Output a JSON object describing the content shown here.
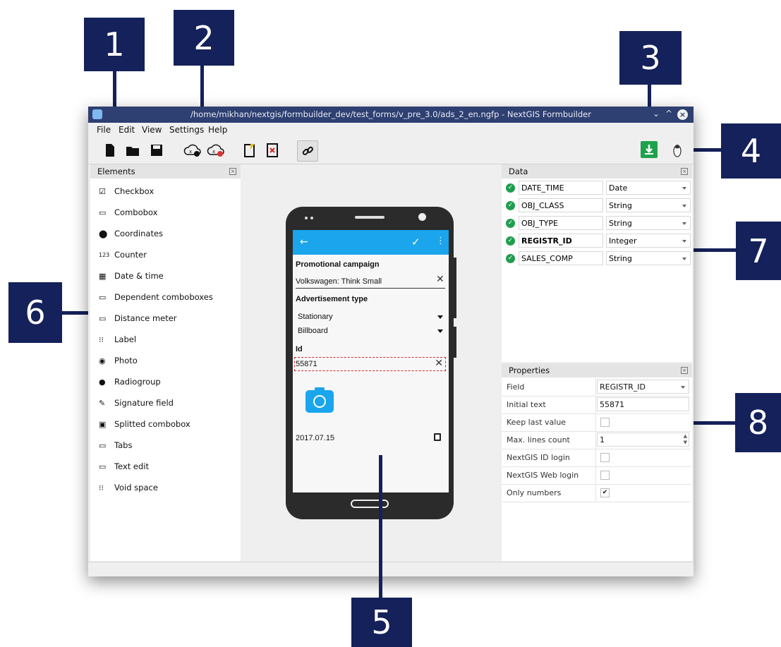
{
  "callouts": [
    "1",
    "2",
    "3",
    "4",
    "5",
    "6",
    "7",
    "8"
  ],
  "window": {
    "title": "/home/mikhan/nextgis/formbuilder_dev/test_forms/v_pre_3.0/ads_2_en.ngfp - NextGIS Formbuilder",
    "controls": {
      "minimize": "⌄",
      "maximize": "^",
      "close": "×"
    }
  },
  "menu": [
    "File",
    "Edit",
    "View",
    "Settings",
    "Help"
  ],
  "toolbar": {
    "icons": [
      "new-file-icon",
      "open-folder-icon",
      "save-icon",
      "cloud-upload-icon",
      "cloud-download-icon",
      "edit-form-icon",
      "delete-form-icon",
      "link-icon",
      "download-icon",
      "tux-icon"
    ]
  },
  "elements": {
    "title": "Elements",
    "items": [
      {
        "icon": "☑",
        "label": "Checkbox"
      },
      {
        "icon": "▭",
        "label": "Combobox"
      },
      {
        "icon": "⬤",
        "label": "Coordinates"
      },
      {
        "icon": "123",
        "label": "Counter"
      },
      {
        "icon": "▦",
        "label": "Date & time"
      },
      {
        "icon": "▭",
        "label": "Dependent comboboxes"
      },
      {
        "icon": "▭",
        "label": "Distance meter"
      },
      {
        "icon": "⁝⁝",
        "label": "Label"
      },
      {
        "icon": "◉",
        "label": "Photo"
      },
      {
        "icon": "●",
        "label": "Radiogroup"
      },
      {
        "icon": "✎",
        "label": "Signature field"
      },
      {
        "icon": "▣",
        "label": "Splitted combobox"
      },
      {
        "icon": "▭",
        "label": "Tabs"
      },
      {
        "icon": "▭",
        "label": "Text edit"
      },
      {
        "icon": "⁝⁝",
        "label": "Void space"
      }
    ]
  },
  "phone_form": {
    "section1": "Promotional campaign",
    "field1_value": "Volkswagen: Think Small",
    "section2": "Advertisement type",
    "select1": "Stationary",
    "select2": "Billboard",
    "section3": "Id",
    "id_value": "55871",
    "date_value": "2017.07.15"
  },
  "data": {
    "title": "Data",
    "rows": [
      {
        "name": "DATE_TIME",
        "type": "Date"
      },
      {
        "name": "OBJ_CLASS",
        "type": "String"
      },
      {
        "name": "OBJ_TYPE",
        "type": "String"
      },
      {
        "name": "REGISTR_ID",
        "type": "Integer"
      },
      {
        "name": "SALES_COMP",
        "type": "String"
      }
    ]
  },
  "properties": {
    "title": "Properties",
    "rows": [
      {
        "key": "Field",
        "value": "REGISTR_ID",
        "kind": "select"
      },
      {
        "key": "Initial text",
        "value": "55871",
        "kind": "text"
      },
      {
        "key": "Keep last value",
        "value": "",
        "kind": "checkbox"
      },
      {
        "key": "Max. lines count",
        "value": "1",
        "kind": "spin"
      },
      {
        "key": "NextGIS ID login",
        "value": "",
        "kind": "checkbox"
      },
      {
        "key": "NextGIS Web login",
        "value": "",
        "kind": "checkbox"
      },
      {
        "key": "Only numbers",
        "value": "✔",
        "kind": "checkbox"
      }
    ]
  },
  "colors": {
    "callout": "#14215a",
    "titlebar": "#2e3f71",
    "appbar": "#1aa5ec",
    "ok": "#1f9e4e",
    "download": "#1fa24e",
    "camera": "#1aa5ec",
    "id_border": "#cc2b2b"
  }
}
